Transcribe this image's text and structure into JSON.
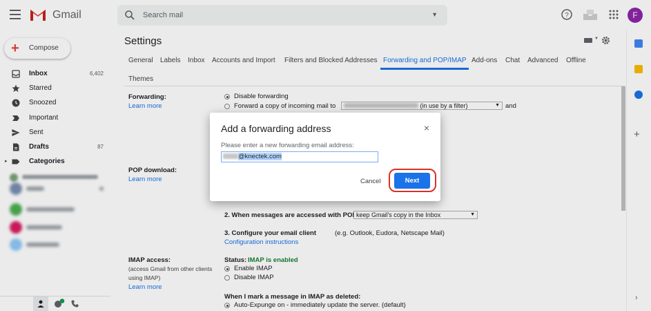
{
  "header": {
    "brand": "Gmail",
    "search_placeholder": "Search mail",
    "avatar_letter": "F"
  },
  "compose": {
    "label": "Compose"
  },
  "nav": [
    {
      "label": "Inbox",
      "count": "6,402",
      "bold": true,
      "icon": "inbox-icon"
    },
    {
      "label": "Starred",
      "count": "",
      "bold": false,
      "icon": "star-icon"
    },
    {
      "label": "Snoozed",
      "count": "",
      "bold": false,
      "icon": "clock-icon"
    },
    {
      "label": "Important",
      "count": "",
      "bold": false,
      "icon": "important-icon"
    },
    {
      "label": "Sent",
      "count": "",
      "bold": false,
      "icon": "send-icon"
    },
    {
      "label": "Drafts",
      "count": "87",
      "bold": true,
      "icon": "draft-icon"
    },
    {
      "label": "Categories",
      "count": "",
      "bold": true,
      "icon": "label-icon"
    }
  ],
  "settings": {
    "title": "Settings",
    "tabs": [
      "General",
      "Labels",
      "Inbox",
      "Accounts and Import",
      "Filters and Blocked Addresses",
      "Forwarding and POP/IMAP",
      "Add-ons",
      "Chat",
      "Advanced",
      "Offline",
      "Themes"
    ],
    "active_tab": "Forwarding and POP/IMAP",
    "forwarding": {
      "label": "Forwarding:",
      "learn_more": "Learn more",
      "option_disable": "Disable forwarding",
      "option_forward": "Forward a copy of incoming mail to",
      "in_use": "(in use by a filter)",
      "and": "and"
    },
    "pop": {
      "label": "POP download:",
      "learn_more": "Learn more",
      "step2": "2. When messages are accessed with POP",
      "step2_select": "keep Gmail's copy in the Inbox",
      "step3": "3. Configure your email client",
      "step3_hint": "(e.g. Outlook, Eudora, Netscape Mail)",
      "config_link": "Configuration instructions"
    },
    "imap": {
      "label": "IMAP access:",
      "sub1": "(access Gmail from other clients",
      "sub2": "using IMAP)",
      "learn_more": "Learn more",
      "status_label": "Status:",
      "status_value": "IMAP is enabled",
      "enable": "Enable IMAP",
      "disable": "Disable IMAP",
      "deleted_heading": "When I mark a message in IMAP as deleted:",
      "auto_expunge": "Auto-Expunge on - immediately update the server. (default)"
    }
  },
  "dialog": {
    "title": "Add a forwarding address",
    "close": "×",
    "prompt": "Please enter a new forwarding email address:",
    "input_value": "@knectek.com",
    "cancel": "Cancel",
    "next": "Next"
  },
  "colors": {
    "accent": "#1a73e8",
    "highlight_ring": "#d93025",
    "imap_status": "#188038"
  }
}
